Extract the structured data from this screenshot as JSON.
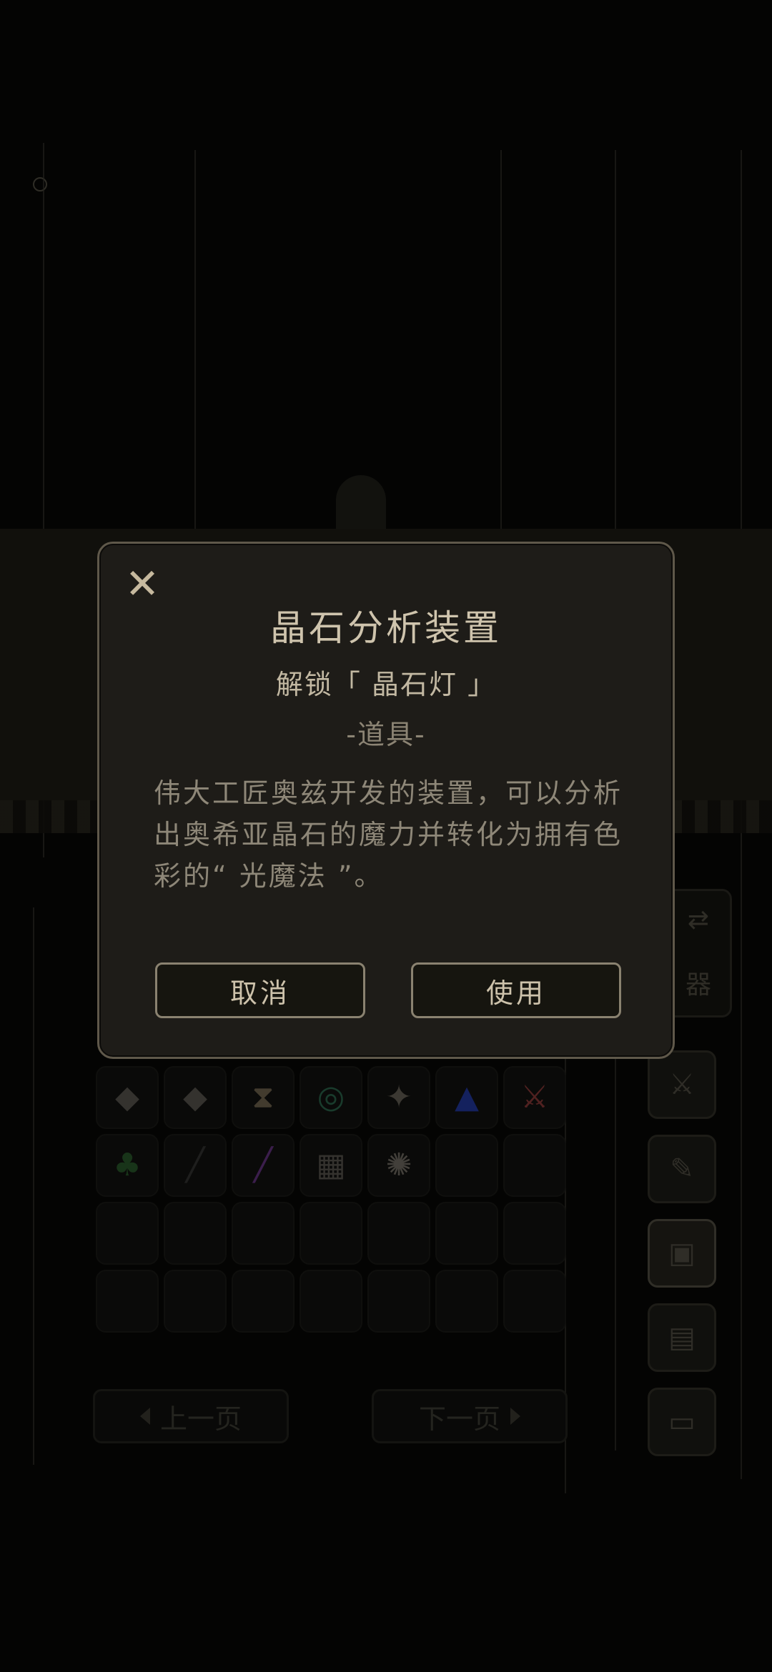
{
  "dialog": {
    "title": "晶石分析装置",
    "subtitle": "解锁「 晶石灯 」",
    "category": "-道具-",
    "description": "伟大工匠奥兹开发的装置，可以分析出奥希亚晶石的魔力并转化为拥有色彩的“ 光魔法 ”。",
    "cancel_label": "取消",
    "use_label": "使用",
    "close_glyph": "✕"
  },
  "inventory": {
    "prev_label": "上一页",
    "next_label": "下一页",
    "weapon_tab_label": "器",
    "row1": [
      {
        "icon": "crystal-cube-icon",
        "glyph": "◆",
        "color": "#6a6660"
      },
      {
        "icon": "crystal-cube-icon",
        "glyph": "◆",
        "color": "#6a6660"
      },
      {
        "icon": "hourglass-icon",
        "glyph": "⧗",
        "color": "#8a7a60"
      },
      {
        "icon": "green-amulet-icon",
        "glyph": "◎",
        "color": "#2f7a5a"
      },
      {
        "icon": "ore-chunk-icon",
        "glyph": "✦",
        "color": "#7a7468"
      },
      {
        "icon": "blue-crystal-icon",
        "glyph": "▲",
        "color": "#2340c8"
      },
      {
        "icon": "red-sword-icon",
        "glyph": "⚔",
        "color": "#a84040"
      }
    ],
    "row2": [
      {
        "icon": "green-armor-icon",
        "glyph": "♣",
        "color": "#2d6a30"
      },
      {
        "icon": "black-staff-icon",
        "glyph": "╱",
        "color": "#3a3a3a"
      },
      {
        "icon": "purple-wand-icon",
        "glyph": "╱",
        "color": "#7a3aa0"
      },
      {
        "icon": "mesh-net-icon",
        "glyph": "▦",
        "color": "#6a6660"
      },
      {
        "icon": "round-gear-icon",
        "glyph": "✺",
        "color": "#8a8478"
      },
      {
        "icon": "",
        "glyph": "",
        "color": "#000000"
      },
      {
        "icon": "",
        "glyph": "",
        "color": "#000000"
      }
    ]
  },
  "side_menu": [
    {
      "icon": "crossed-swords-icon",
      "glyph": "⚔"
    },
    {
      "icon": "scroll-icon",
      "glyph": "✎"
    },
    {
      "icon": "chest-icon",
      "glyph": "▣"
    },
    {
      "icon": "book-icon",
      "glyph": "▤"
    },
    {
      "icon": "computer-icon",
      "glyph": "▭"
    }
  ]
}
